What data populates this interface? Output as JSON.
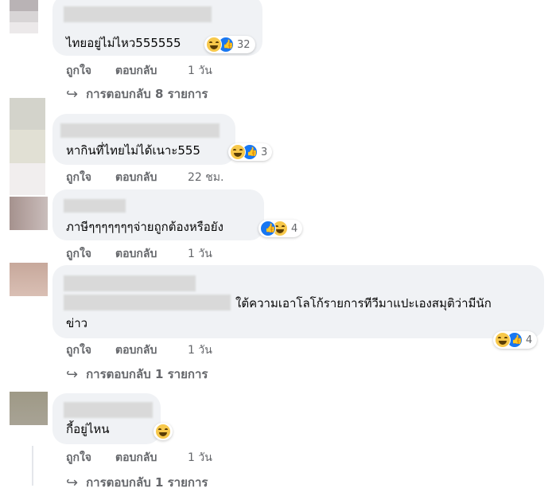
{
  "comments": [
    {
      "text": "ไทยอยู่ไม่ไหว555555",
      "reactions": [
        "haha",
        "like"
      ],
      "reaction_count": "32",
      "like_label": "ถูกใจ",
      "reply_label": "ตอบกลับ",
      "time": "1 วัน",
      "replies_label": "การตอบกลับ 8 รายการ"
    },
    {
      "text": "หากินที่ไทยไม่ได้เนาะ555",
      "reactions": [
        "haha",
        "like"
      ],
      "reaction_count": "3",
      "like_label": "ถูกใจ",
      "reply_label": "ตอบกลับ",
      "time": "22 ชม."
    },
    {
      "text": "ภาษีๆๆๆๆๆๆๆจ่ายถูกต้องหรือยัง",
      "reactions": [
        "like",
        "haha"
      ],
      "reaction_count": "4",
      "like_label": "ถูกใจ",
      "reply_label": "ตอบกลับ",
      "time": "1 วัน"
    },
    {
      "text_line1": "ใต้ความเอาโลโก้รายการทีวีมาแปะเองสมุติว่ามีนัก",
      "text_line2": "ข่าว",
      "reactions": [
        "haha",
        "like"
      ],
      "reaction_count": "4",
      "like_label": "ถูกใจ",
      "reply_label": "ตอบกลับ",
      "time": "1 วัน",
      "replies_label": "การตอบกลับ 1 รายการ"
    },
    {
      "text": "กี้อยู่ไหน",
      "reactions": [
        "haha"
      ],
      "like_label": "ถูกใจ",
      "reply_label": "ตอบกลับ",
      "time": "1 วัน",
      "replies_label": "การตอบกลับ 1 รายการ"
    }
  ],
  "colors": {
    "bubble": "#f0f2f5",
    "meta_text": "#65676b",
    "like_blue": "#1877f2",
    "haha_yellow": "#f7c84b"
  }
}
